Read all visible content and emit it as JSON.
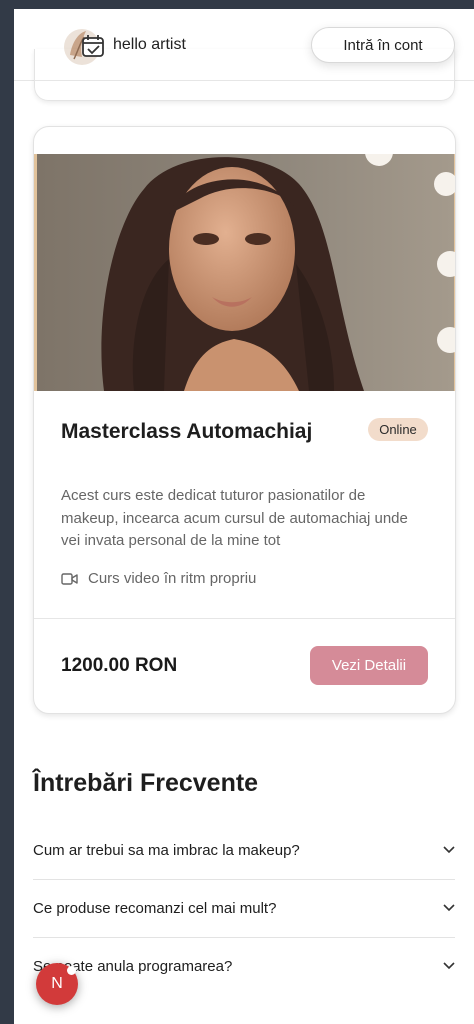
{
  "header": {
    "brand": "hello artist",
    "login_label": "Intră în cont"
  },
  "course": {
    "title": "Masterclass Automachiaj",
    "badge": "Online",
    "description": "Acest curs este dedicat tuturor pasionatilor de makeup, incearca acum cursul de automachiaj unde vei invata personal de la mine tot",
    "meta_icon": "video-icon",
    "meta": "Curs video în ritm propriu",
    "price": "1200.00 RON",
    "details_label": "Vezi Detalii"
  },
  "faq": {
    "title": "Întrebări Frecvente",
    "items": [
      {
        "question": "Cum ar trebui sa ma imbrac la makeup?"
      },
      {
        "question": "Ce produse recomanzi cel mai mult?"
      },
      {
        "question": "Se poate anula programarea?"
      }
    ]
  },
  "fab": {
    "label": "N"
  },
  "colors": {
    "primary_button": "#d58b98",
    "badge_bg": "#f2dccb",
    "fab_bg": "#d23a3a",
    "page_bg": "#323a47"
  }
}
